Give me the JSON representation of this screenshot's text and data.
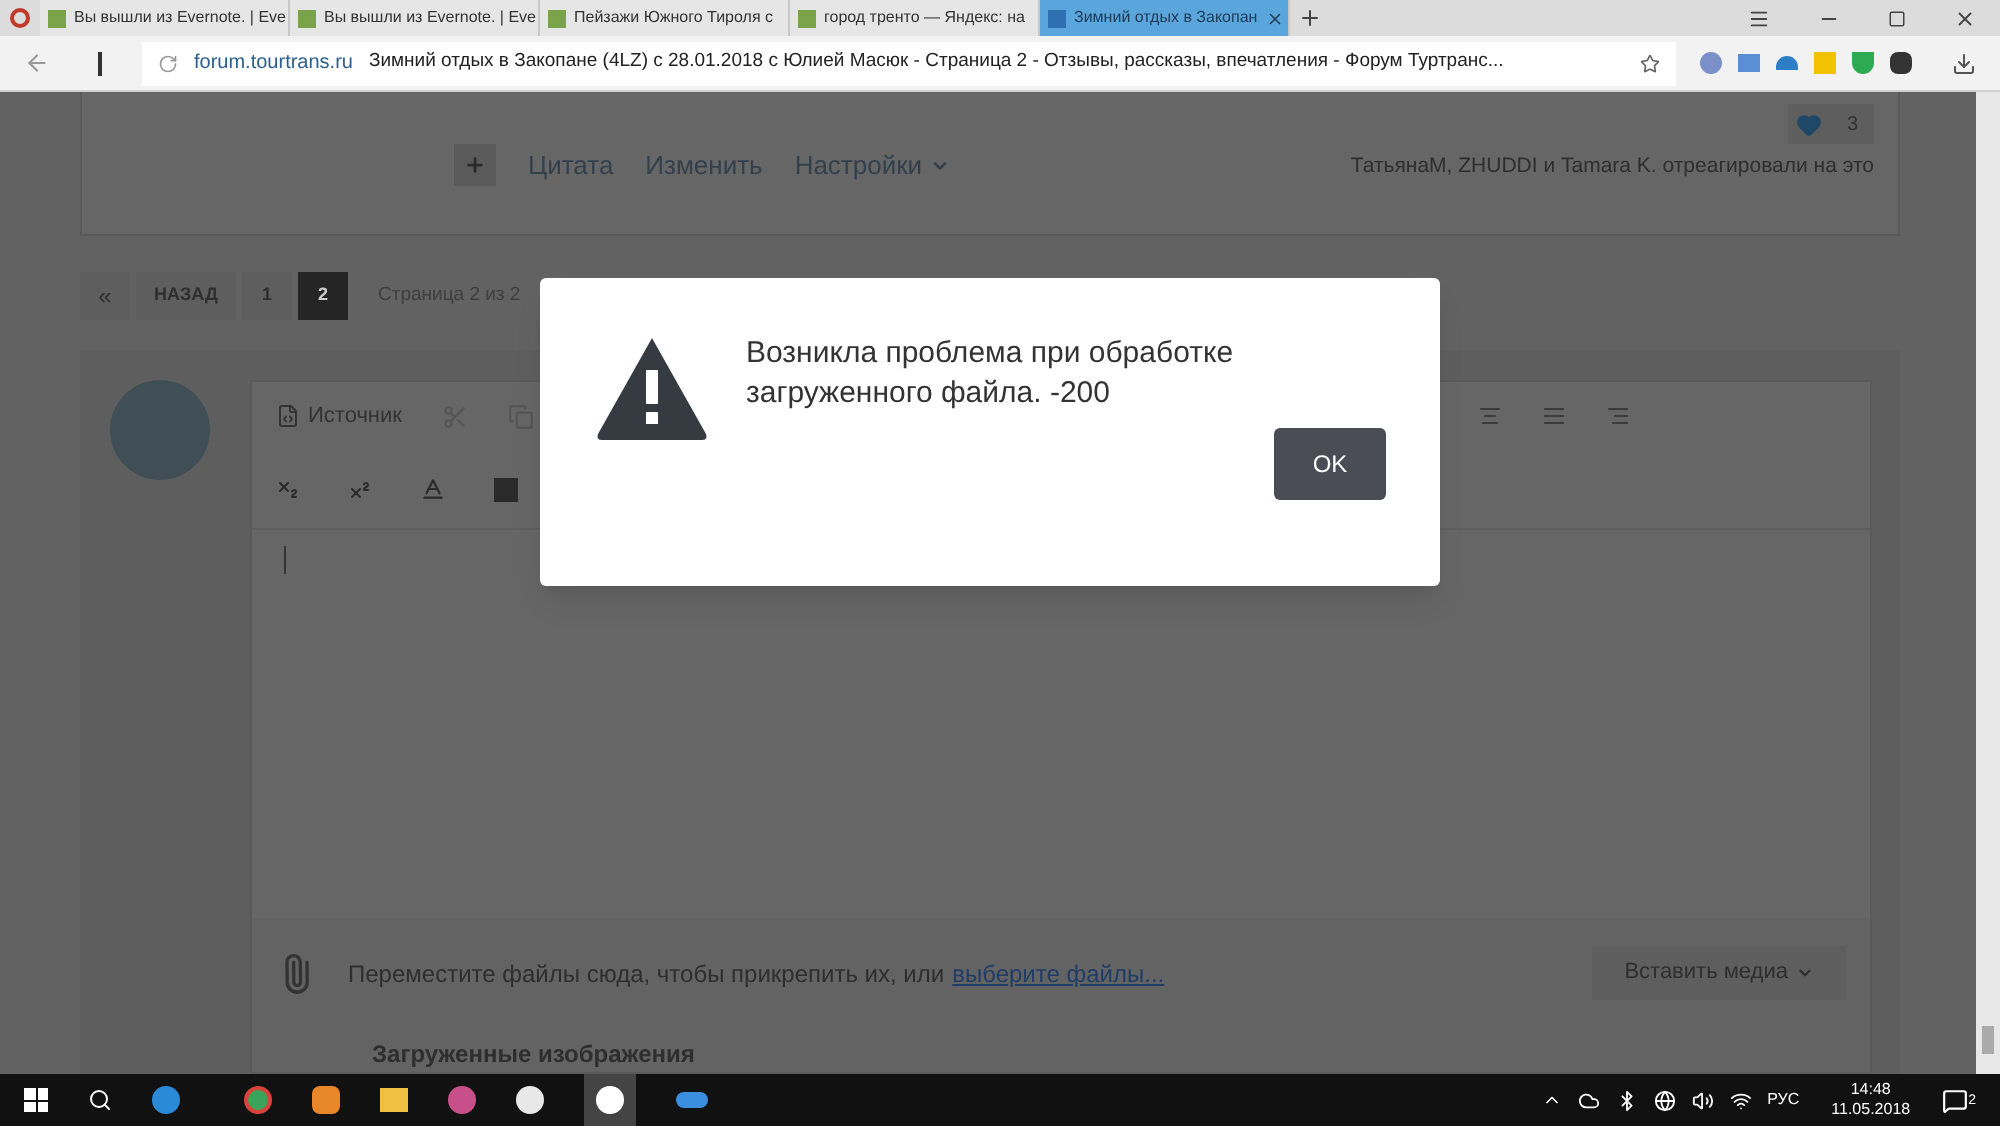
{
  "browser": {
    "tabs": [
      {
        "title": "Вы вышли из Evernote. | Eve",
        "selected": false
      },
      {
        "title": "Вы вышли из Evernote. | Eve",
        "selected": false
      },
      {
        "title": "Пейзажи Южного Тироля с",
        "selected": false
      },
      {
        "title": "город тренто — Яндекс: на",
        "selected": false
      },
      {
        "title": "Зимний отдых в Закопан",
        "selected": true
      }
    ],
    "address": {
      "domain": "forum.tourtrans.ru",
      "title": "Зимний отдых в Закопане (4LZ) с 28.01.2018 с Юлией Масюк - Страница 2 - Отзывы, рассказы, впечатления - Форум Туртранс..."
    }
  },
  "post": {
    "actions": [
      {
        "label": "Цитата",
        "kind": "link"
      },
      {
        "label": "Изменить",
        "kind": "link"
      },
      {
        "label": "Настройки",
        "kind": "menu"
      }
    ],
    "reactions": {
      "count": "3",
      "text": "ТатьянаM, ZHUDDI и Tamara K. отреагировали на это"
    }
  },
  "pagination": {
    "first": "«",
    "back": "НАЗАД",
    "pages": [
      {
        "label": "1",
        "selected": false
      },
      {
        "label": "2",
        "selected": true
      }
    ],
    "info": "Страница 2 из 2"
  },
  "editor": {
    "source_label": "Источник"
  },
  "attachments": {
    "prompt": "Переместите файлы сюда, чтобы прикрепить их, или",
    "link": "выберите файлы...",
    "insert_media": "Вставить медиа",
    "uploaded_heading": "Загруженные изображения"
  },
  "dialog": {
    "message": "Возникла проблема при обработке загруженного файла. -200",
    "button": "OK"
  },
  "taskbar": {
    "language": "РУС",
    "time": "14:48",
    "date": "11.05.2018",
    "notifications": "2"
  }
}
